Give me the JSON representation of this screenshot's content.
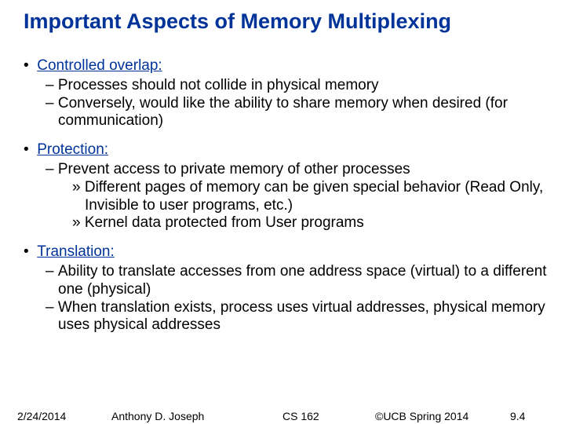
{
  "title": "Important Aspects of Memory Multiplexing",
  "sections": [
    {
      "heading": "Controlled overlap:",
      "sub": [
        "Processes should not collide in physical memory",
        "Conversely, would like the ability to share memory when desired (for communication)"
      ],
      "subsub": []
    },
    {
      "heading": "Protection:",
      "sub": [
        "Prevent access to private memory of other processes"
      ],
      "subsub": [
        "Different pages of memory can be given special behavior (Read Only, Invisible to user programs, etc.)",
        "Kernel data protected from User programs"
      ]
    },
    {
      "heading": "Translation:",
      "sub": [
        "Ability to translate accesses from one address space (virtual) to a different one (physical)",
        "When translation exists, process uses virtual addresses, physical memory uses physical addresses"
      ],
      "subsub": []
    }
  ],
  "footer": {
    "date": "2/24/2014",
    "author": "Anthony D. Joseph",
    "course": "CS 162",
    "copyright": "©UCB Spring 2014",
    "page": "9.4"
  }
}
